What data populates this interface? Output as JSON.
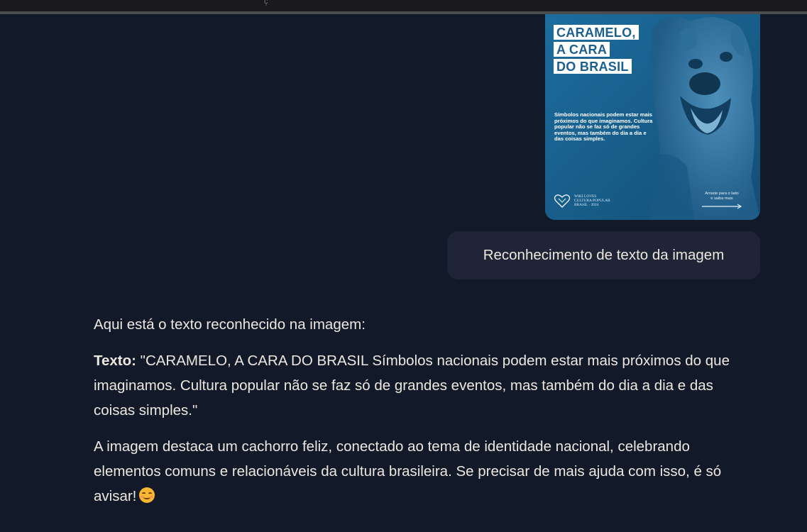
{
  "window": {
    "top_partial_text": "ç"
  },
  "user_message": {
    "attachment": {
      "poster_title_lines": [
        "CARAMELO,",
        "A CARA",
        "DO BRASIL"
      ],
      "poster_body": "Símbolos nacionais podem estar mais próximos do que imaginamos. Cultura popular não se faz só de grandes eventos, mas também do dia a dia e das coisas simples.",
      "logo_text_lines": [
        "WIKI LOVES",
        "CULTURA POPULAR",
        "BRASIL · 2024"
      ],
      "swipe_text_lines": [
        "Arraste para o lado",
        "e saiba mais"
      ]
    },
    "text": "Reconhecimento de texto da imagem"
  },
  "assistant_message": {
    "intro": "Aqui está o texto reconhecido na imagem:",
    "label": "Texto:",
    "quoted": " \"CARAMELO, A CARA DO BRASIL Símbolos nacionais podem estar mais próximos do que imaginamos. Cultura popular não se faz só de grandes eventos, mas também do dia a dia e das coisas simples.\"",
    "closing": "A imagem destaca um cachorro feliz, conectado ao tema de identidade nacional, celebrando elementos comuns e relacionáveis da cultura brasileira. Se precisar de mais ajuda com isso, é só avisar!",
    "emoji": "smiling-face-icon"
  },
  "colors": {
    "background": "#121a2a",
    "bubble": "#1f2437",
    "text": "#ece7df",
    "poster_blue": "#1b6a9a"
  }
}
